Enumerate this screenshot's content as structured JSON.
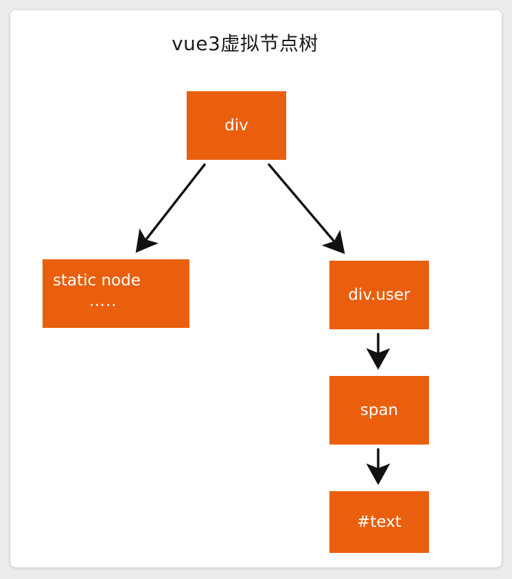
{
  "title": "vue3虚拟节点树",
  "colors": {
    "node_fill": "#ea5f0d",
    "node_text": "#ffffff",
    "arrow": "#111111",
    "background": "#ffffff"
  },
  "nodes": {
    "root": {
      "label": "div"
    },
    "static": {
      "label": "static node",
      "sub_label": "….."
    },
    "user": {
      "label": "div.user"
    },
    "span": {
      "label": "span"
    },
    "text": {
      "label": "#text"
    }
  },
  "edges": [
    {
      "from": "div",
      "to": "static node"
    },
    {
      "from": "div",
      "to": "div.user"
    },
    {
      "from": "div.user",
      "to": "span"
    },
    {
      "from": "span",
      "to": "#text"
    }
  ]
}
